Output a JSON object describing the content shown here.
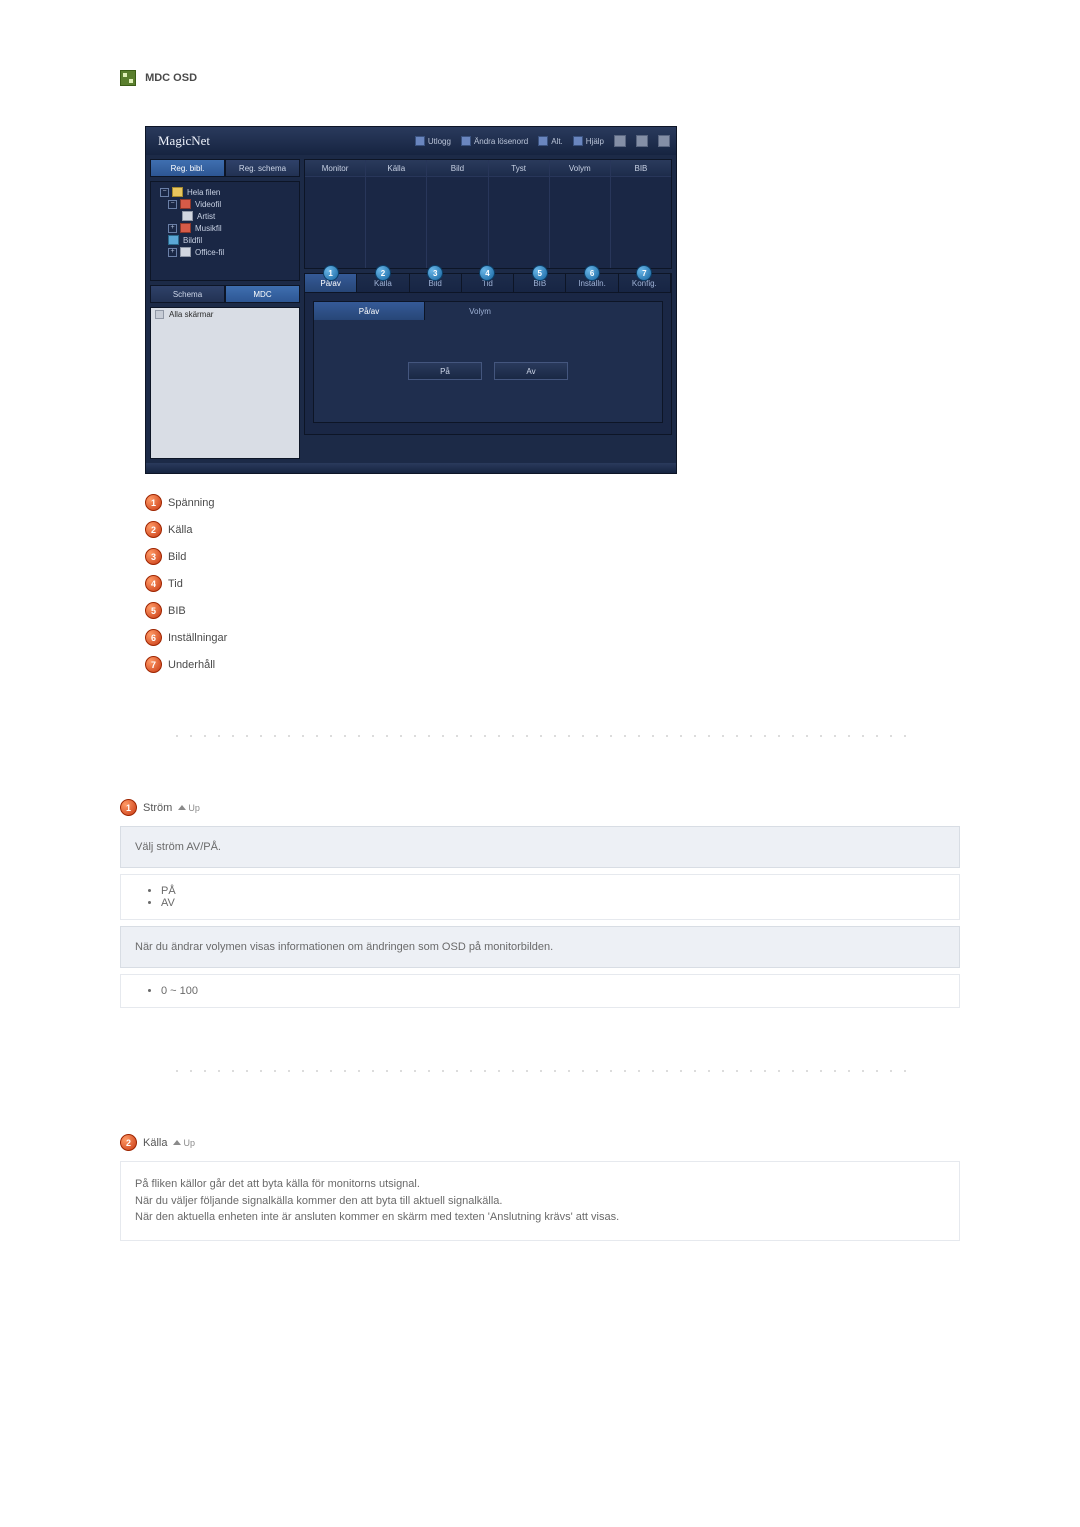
{
  "page": {
    "title": "MDC OSD"
  },
  "screenshot": {
    "logo": "MagicNet",
    "topbar": {
      "logout": "Utlogg",
      "change_pw": "Ändra lösenord",
      "alt": "Alt.",
      "help": "Hjälp"
    },
    "left": {
      "tab_library": "Reg. bibl.",
      "tab_schedule": "Reg. schema",
      "tree": {
        "root": "Hela filen",
        "video": "Videofil",
        "artist": "Artist",
        "music": "Musikfil",
        "picture": "Bildfil",
        "office": "Office-fil"
      },
      "tab_schema": "Schema",
      "tab_mdc": "MDC",
      "list_all": "Alla skärmar"
    },
    "grid_headers": {
      "monitor": "Monitor",
      "source": "Källa",
      "picture": "Bild",
      "mute": "Tyst",
      "volume": "Volym",
      "pip": "BIB"
    },
    "bottom_tabs": {
      "power": "På/av",
      "source": "Källa",
      "picture": "Bild",
      "time": "Tid",
      "pip": "BIB",
      "settings": "Inställn.",
      "maint": "Konfig."
    },
    "inner": {
      "tab_power": "På/av",
      "tab_volume": "Volym",
      "btn_on": "På",
      "btn_off": "Av"
    }
  },
  "legend": {
    "i1": "Spänning",
    "i2": "Källa",
    "i3": "Bild",
    "i4": "Tid",
    "i5": "BIB",
    "i6": "Inställningar",
    "i7": "Underhåll"
  },
  "sections": {
    "s1": {
      "title": "Ström",
      "up": "Up",
      "box1": "Välj ström AV/PÅ.",
      "opt_on": "PÅ",
      "opt_off": "AV",
      "box2": "När du ändrar volymen visas informationen om ändringen som OSD på monitorbilden.",
      "range": "0 ~ 100"
    },
    "s2": {
      "title": "Källa",
      "up": "Up",
      "line1": "På fliken källor går det att byta källa för monitorns utsignal.",
      "line2": "När du väljer följande signalkälla kommer den att byta till aktuell signalkälla.",
      "line3": "När den aktuella enheten inte är ansluten kommer en skärm med texten 'Anslutning krävs' att visas."
    }
  }
}
